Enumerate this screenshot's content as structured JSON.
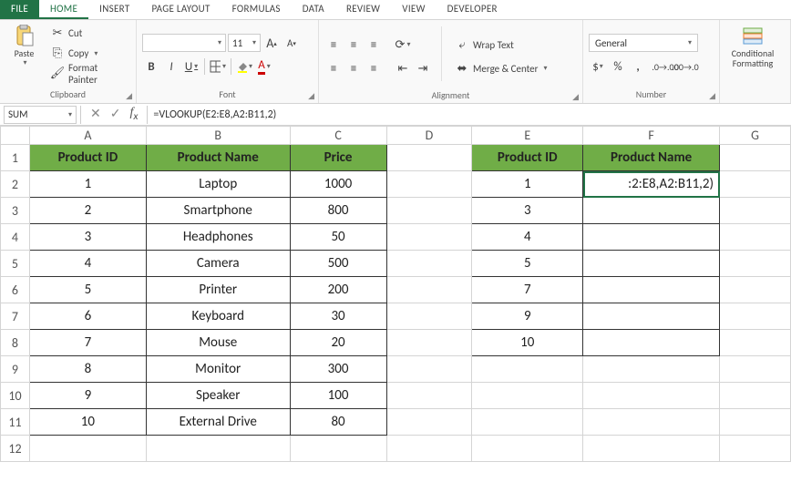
{
  "tabs": {
    "file": "FILE",
    "home": "HOME",
    "insert": "INSERT",
    "pagelayout": "PAGE LAYOUT",
    "formulas": "FORMULAS",
    "data": "DATA",
    "review": "REVIEW",
    "view": "VIEW",
    "developer": "DEVELOPER"
  },
  "ribbon": {
    "clipboard": {
      "label": "Clipboard",
      "paste": "Paste",
      "cut": "Cut",
      "copy": "Copy",
      "formatpainter": "Format Painter"
    },
    "font": {
      "label": "Font",
      "family": "",
      "size": "11",
      "bold": "B",
      "italic": "I",
      "underline": "U",
      "incsize": "A",
      "decsize": "A",
      "fontcolor": "A"
    },
    "alignment": {
      "label": "Alignment",
      "wrap": "Wrap Text",
      "merge": "Merge & Center"
    },
    "number": {
      "label": "Number",
      "format": "General",
      "currency": "$",
      "percent": "%",
      "comma": ","
    },
    "styles": {
      "cond": "Conditional",
      "cond2": "Formatting"
    }
  },
  "fbar": {
    "name": "SUM",
    "formula": "=VLOOKUP(E2:E8,A2:B11,2)"
  },
  "cols": [
    "A",
    "B",
    "C",
    "D",
    "E",
    "F",
    "G"
  ],
  "rows": [
    "1",
    "2",
    "3",
    "4",
    "5",
    "6",
    "7",
    "8",
    "9",
    "10",
    "11",
    "12"
  ],
  "table1": {
    "headers": {
      "a": "Product ID",
      "b": "Product Name",
      "c": "Price"
    },
    "rows": [
      {
        "id": "1",
        "name": "Laptop",
        "price": "1000"
      },
      {
        "id": "2",
        "name": "Smartphone",
        "price": "800"
      },
      {
        "id": "3",
        "name": "Headphones",
        "price": "50"
      },
      {
        "id": "4",
        "name": "Camera",
        "price": "500"
      },
      {
        "id": "5",
        "name": "Printer",
        "price": "200"
      },
      {
        "id": "6",
        "name": "Keyboard",
        "price": "30"
      },
      {
        "id": "7",
        "name": "Mouse",
        "price": "20"
      },
      {
        "id": "8",
        "name": "Monitor",
        "price": "300"
      },
      {
        "id": "9",
        "name": "Speaker",
        "price": "100"
      },
      {
        "id": "10",
        "name": "External Drive",
        "price": "80"
      }
    ]
  },
  "table2": {
    "headers": {
      "e": "Product ID",
      "f": "Product Name"
    },
    "rows": [
      {
        "id": "1",
        "name": ":2:E8,A2:B11,2)"
      },
      {
        "id": "3",
        "name": ""
      },
      {
        "id": "4",
        "name": ""
      },
      {
        "id": "5",
        "name": ""
      },
      {
        "id": "7",
        "name": ""
      },
      {
        "id": "9",
        "name": ""
      },
      {
        "id": "10",
        "name": ""
      }
    ]
  },
  "colwidths": {
    "A": 128,
    "B": 158,
    "C": 106,
    "D": 94,
    "E": 122,
    "F": 150,
    "G": 78
  }
}
